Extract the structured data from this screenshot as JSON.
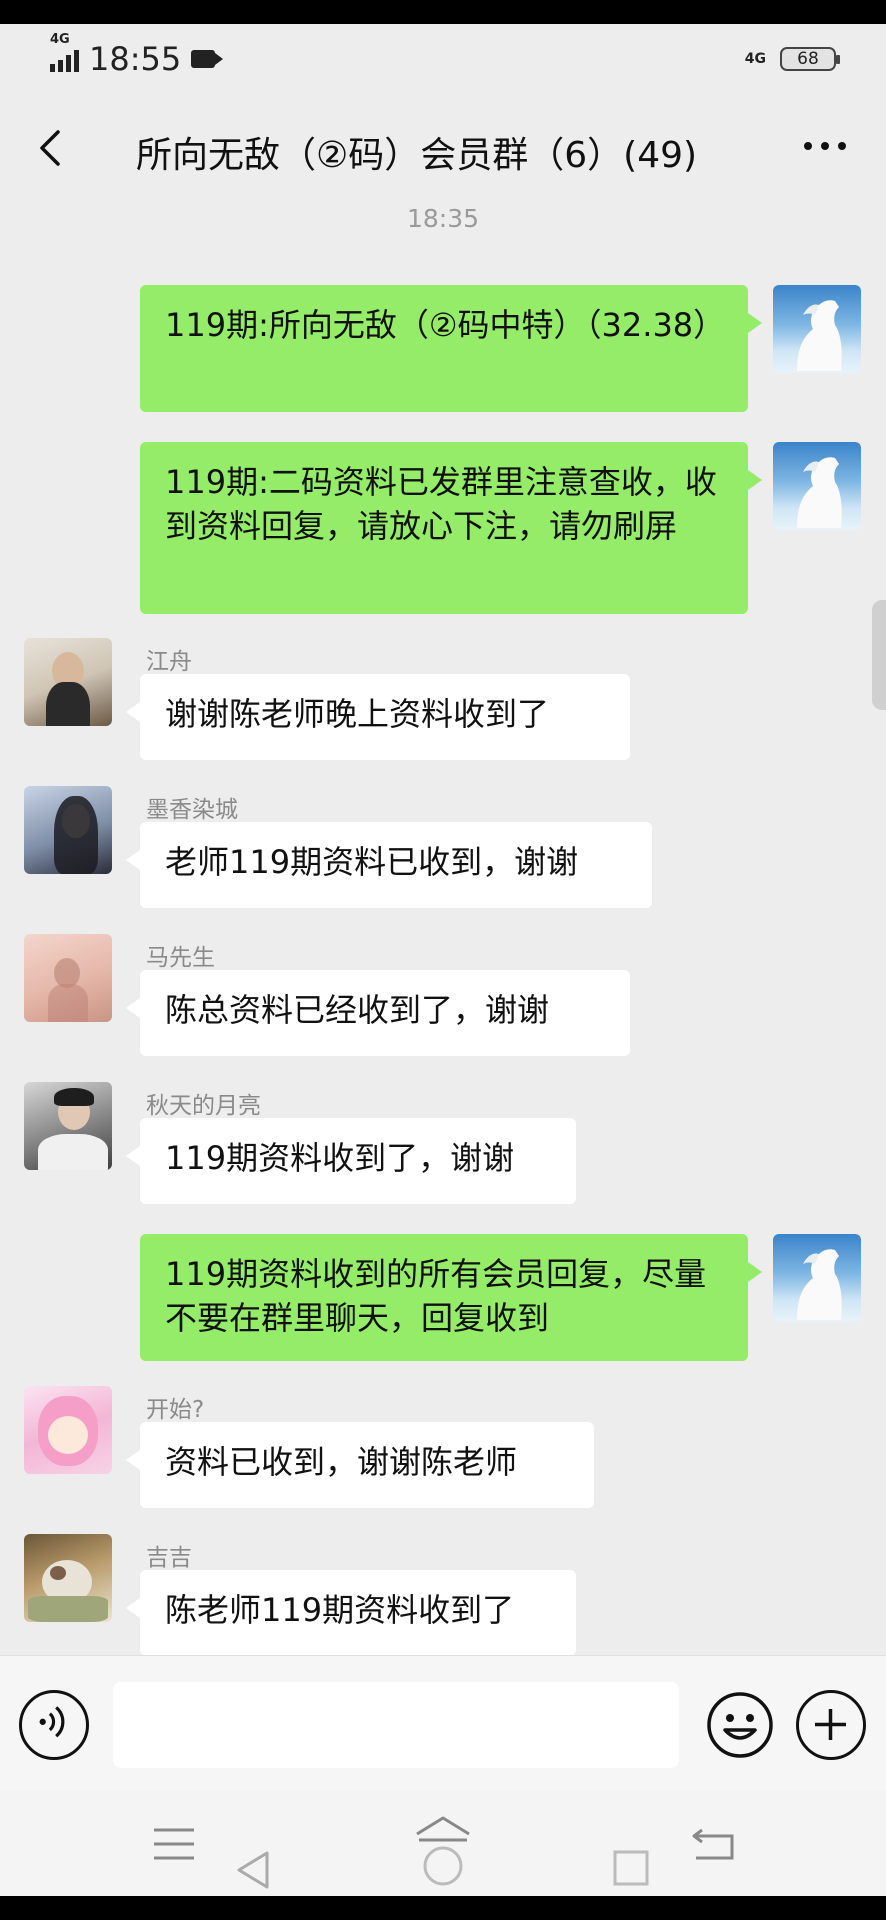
{
  "status_bar": {
    "network_left": "4G",
    "time": "18:55",
    "network_right": "4G",
    "battery": "68"
  },
  "header": {
    "title": "所向无敌（②码）会员群（6）(49)"
  },
  "chat": {
    "timestamp": "18:35",
    "messages": [
      {
        "sender": "me",
        "name": "",
        "text": "119期:所向无敌（②码中特）（32.38）",
        "avatar": "white-horse-avatar"
      },
      {
        "sender": "me",
        "name": "",
        "text": "119期:二码资料已发群里注意查收，收到资料回复，请放心下注，请勿刷屏",
        "avatar": "white-horse-avatar"
      },
      {
        "sender": "other",
        "name": "江舟",
        "text": "谢谢陈老师晚上资料收到了",
        "avatar": "girl-avatar"
      },
      {
        "sender": "other",
        "name": "墨香染城",
        "text": "老师119期资料已收到，谢谢",
        "avatar": "girl-avatar"
      },
      {
        "sender": "other",
        "name": "马先生",
        "text": "陈总资料已经收到了，谢谢",
        "avatar": "silhouette-avatar"
      },
      {
        "sender": "other",
        "name": "秋天的月亮",
        "text": "119期资料收到了，谢谢",
        "avatar": "boy-avatar"
      },
      {
        "sender": "me",
        "name": "",
        "text": "119期资料收到的所有会员回复，尽量不要在群里聊天，回复收到",
        "avatar": "white-horse-avatar"
      },
      {
        "sender": "other",
        "name": "开始?",
        "text": "资料已收到，谢谢陈老师",
        "avatar": "anime-avatar"
      },
      {
        "sender": "other",
        "name": "吉吉",
        "text": "陈老师119期资料收到了",
        "avatar": "cat-avatar"
      }
    ]
  },
  "input_bar": {
    "placeholder": "",
    "icons": [
      "voice-icon",
      "emoji-icon",
      "plus-icon"
    ]
  },
  "nav_bar": {
    "icons": [
      "menu-icon",
      "back-triangle-icon",
      "home-icon",
      "recents-icon",
      "return-icon"
    ]
  },
  "colors": {
    "me_bubble": "#95ec69",
    "other_bubble": "#ffffff",
    "background": "#ededed"
  }
}
